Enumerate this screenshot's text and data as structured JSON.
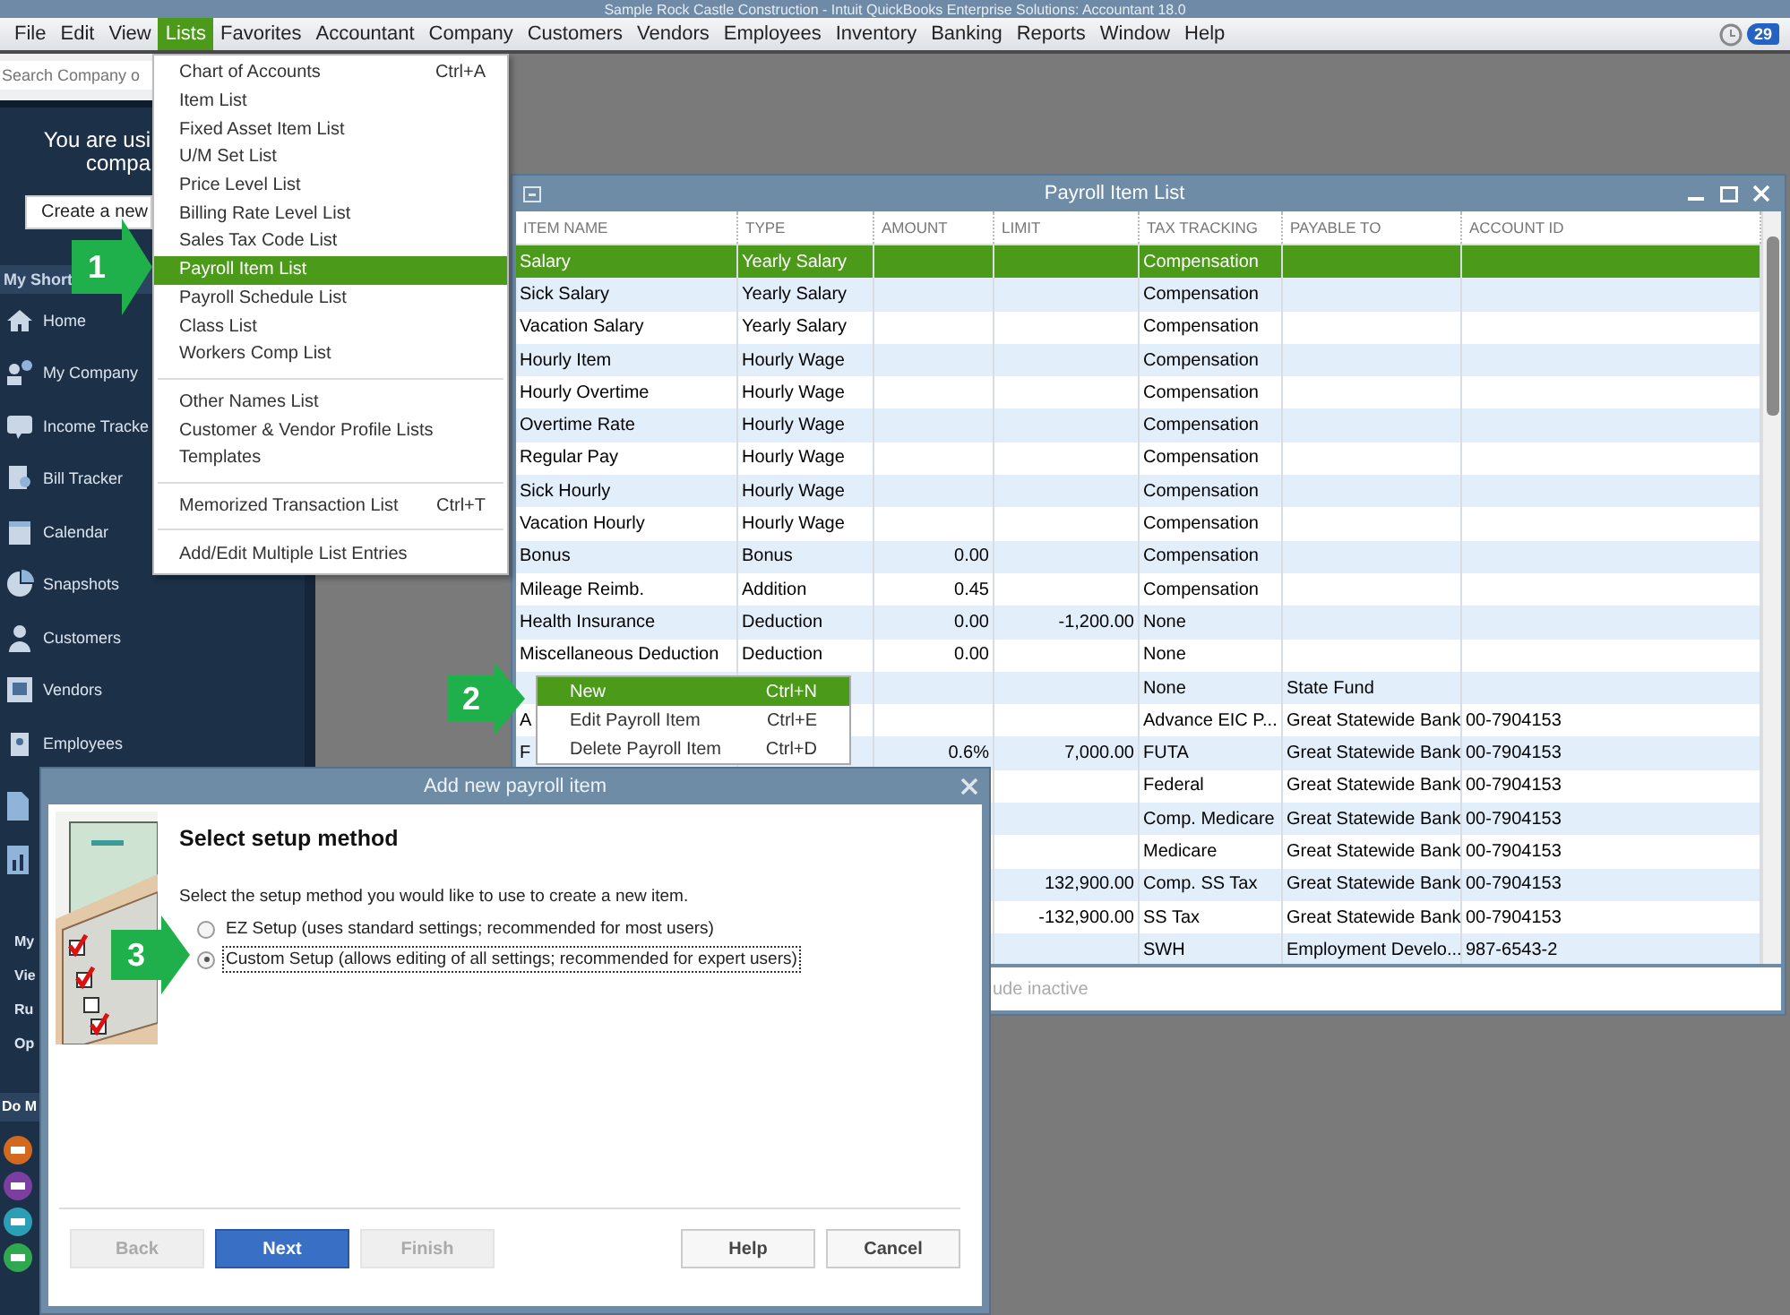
{
  "window": {
    "title": "Sample Rock Castle Construction - Intuit QuickBooks Enterprise Solutions: Accountant 18.0"
  },
  "menu_bar": [
    {
      "label": "File",
      "selected": false
    },
    {
      "label": "Edit",
      "selected": false
    },
    {
      "label": "View",
      "selected": false
    },
    {
      "label": "Lists",
      "selected": true
    },
    {
      "label": "Favorites",
      "selected": false
    },
    {
      "label": "Accountant",
      "selected": false
    },
    {
      "label": "Company",
      "selected": false
    },
    {
      "label": "Customers",
      "selected": false
    },
    {
      "label": "Vendors",
      "selected": false
    },
    {
      "label": "Employees",
      "selected": false
    },
    {
      "label": "Inventory",
      "selected": false
    },
    {
      "label": "Banking",
      "selected": false
    },
    {
      "label": "Reports",
      "selected": false
    },
    {
      "label": "Window",
      "selected": false
    },
    {
      "label": "Help",
      "selected": false
    }
  ],
  "reminders": {
    "count": "29"
  },
  "sidebar": {
    "search": {
      "placeholder": "Search Company o"
    },
    "notice": [
      "You are usi",
      "compa"
    ],
    "create_button": "Create a new",
    "shortcuts_header": "My Short",
    "items": [
      {
        "label": "Home"
      },
      {
        "label": "My Company"
      },
      {
        "label": "Income Tracke"
      },
      {
        "label": "Bill Tracker"
      },
      {
        "label": "Calendar"
      },
      {
        "label": "Snapshots"
      },
      {
        "label": "Customers"
      },
      {
        "label": "Vendors"
      },
      {
        "label": "Employees"
      }
    ],
    "sections": [
      {
        "label": "My"
      },
      {
        "label": "Vie"
      },
      {
        "label": "Ru"
      },
      {
        "label": "Op"
      }
    ],
    "do_more_header": "Do M"
  },
  "lists_menu": [
    [
      {
        "label": "Chart of Accounts",
        "shortcut": "Ctrl+A",
        "selected": false
      },
      {
        "label": "Item List",
        "selected": false
      },
      {
        "label": "Fixed Asset Item List",
        "selected": false
      },
      {
        "label": "U/M Set List",
        "selected": false
      },
      {
        "label": "Price Level List",
        "selected": false
      },
      {
        "label": "Billing Rate Level List",
        "selected": false
      },
      {
        "label": "Sales Tax Code List",
        "selected": false
      },
      {
        "label": "Payroll Item List",
        "selected": true
      },
      {
        "label": "Payroll Schedule List",
        "selected": false
      },
      {
        "label": "Class List",
        "selected": false
      },
      {
        "label": "Workers Comp List",
        "selected": false
      }
    ],
    [
      {
        "label": "Other Names List",
        "selected": false
      },
      {
        "label": "Customer & Vendor Profile Lists",
        "selected": false
      },
      {
        "label": "Templates",
        "selected": false
      }
    ],
    [
      {
        "label": "Memorized Transaction List",
        "shortcut": "Ctrl+T",
        "selected": false
      }
    ],
    [
      {
        "label": "Add/Edit Multiple List Entries",
        "selected": false
      }
    ]
  ],
  "payroll_list": {
    "title": "Payroll Item List",
    "columns": [
      "ITEM NAME",
      "TYPE",
      "AMOUNT",
      "LIMIT",
      "TAX TRACKING",
      "PAYABLE TO",
      "ACCOUNT ID"
    ],
    "rows": [
      {
        "selected": true,
        "item_name": "Salary",
        "type": "Yearly Salary",
        "tax_tracking": "Compensation"
      },
      {
        "selected": false,
        "item_name": "Sick Salary",
        "type": "Yearly Salary",
        "tax_tracking": "Compensation"
      },
      {
        "selected": false,
        "item_name": "Vacation Salary",
        "type": "Yearly Salary",
        "tax_tracking": "Compensation"
      },
      {
        "selected": false,
        "item_name": "Hourly Item",
        "type": "Hourly Wage",
        "tax_tracking": "Compensation"
      },
      {
        "selected": false,
        "item_name": "Hourly Overtime",
        "type": "Hourly Wage",
        "tax_tracking": "Compensation"
      },
      {
        "selected": false,
        "item_name": "Overtime Rate",
        "type": "Hourly Wage",
        "tax_tracking": "Compensation"
      },
      {
        "selected": false,
        "item_name": "Regular Pay",
        "type": "Hourly Wage",
        "tax_tracking": "Compensation"
      },
      {
        "selected": false,
        "item_name": "Sick Hourly",
        "type": "Hourly Wage",
        "tax_tracking": "Compensation"
      },
      {
        "selected": false,
        "item_name": "Vacation Hourly",
        "type": "Hourly Wage",
        "tax_tracking": "Compensation"
      },
      {
        "selected": false,
        "item_name": "Bonus",
        "type": "Bonus",
        "amount": "0.00",
        "tax_tracking": "Compensation"
      },
      {
        "selected": false,
        "item_name": "Mileage Reimb.",
        "type": "Addition",
        "amount": "0.45",
        "tax_tracking": "Compensation"
      },
      {
        "selected": false,
        "item_name": "Health Insurance",
        "type": "Deduction",
        "amount": "0.00",
        "limit": "-1,200.00",
        "tax_tracking": "None"
      },
      {
        "selected": false,
        "item_name": "Miscellaneous Deduction",
        "type": "Deduction",
        "amount": "0.00",
        "tax_tracking": "None"
      },
      {
        "selected": false,
        "tax_tracking": "None",
        "payable_to": "State Fund"
      },
      {
        "selected": false,
        "item_name": "A",
        "tax_tracking": "Advance EIC P...",
        "payable_to": "Great Statewide Bank",
        "account_id": "00-7904153"
      },
      {
        "selected": false,
        "item_name": "F",
        "amount": "0.6%",
        "limit": "7,000.00",
        "tax_tracking": "FUTA",
        "payable_to": "Great Statewide Bank",
        "account_id": "00-7904153"
      },
      {
        "selected": false,
        "tax_tracking": "Federal",
        "payable_to": "Great Statewide Bank",
        "account_id": "00-7904153"
      },
      {
        "selected": false,
        "tax_tracking": "Comp. Medicare",
        "payable_to": "Great Statewide Bank",
        "account_id": "00-7904153"
      },
      {
        "selected": false,
        "tax_tracking": "Medicare",
        "payable_to": "Great Statewide Bank",
        "account_id": "00-7904153"
      },
      {
        "selected": false,
        "limit": "132,900.00",
        "tax_tracking": "Comp. SS Tax",
        "payable_to": "Great Statewide Bank",
        "account_id": "00-7904153"
      },
      {
        "selected": false,
        "limit": "-132,900.00",
        "tax_tracking": "SS Tax",
        "payable_to": "Great Statewide Bank",
        "account_id": "00-7904153"
      },
      {
        "selected": false,
        "tax_tracking": "SWH",
        "payable_to": "Employment Develo...",
        "account_id": "987-6543-2"
      }
    ],
    "footer_text": "ude inactive"
  },
  "context_menu": [
    {
      "label": "New",
      "shortcut": "Ctrl+N",
      "selected": true
    },
    {
      "label": "Edit Payroll Item",
      "shortcut": "Ctrl+E",
      "selected": false
    },
    {
      "label": "Delete Payroll Item",
      "shortcut": "Ctrl+D",
      "selected": false
    }
  ],
  "dialog": {
    "title": "Add new payroll item",
    "heading": "Select setup method",
    "prompt": "Select the setup method you would like to use to create a new item.",
    "options": [
      {
        "label": "EZ Setup (uses standard settings; recommended for most users)",
        "selected": false
      },
      {
        "label": "Custom Setup (allows editing of all settings; recommended for expert users)",
        "selected": true
      }
    ],
    "buttons": [
      {
        "label": "Back",
        "kind": "plain",
        "disabled": true
      },
      {
        "label": "Next",
        "kind": "primary",
        "disabled": false
      },
      {
        "label": "Finish",
        "kind": "plain",
        "disabled": true
      },
      {
        "label": "Help",
        "kind": "plain",
        "disabled": false
      },
      {
        "label": "Cancel",
        "kind": "plain",
        "disabled": false
      }
    ]
  },
  "steps": [
    {
      "label": "1"
    },
    {
      "label": "2"
    },
    {
      "label": "3"
    }
  ]
}
